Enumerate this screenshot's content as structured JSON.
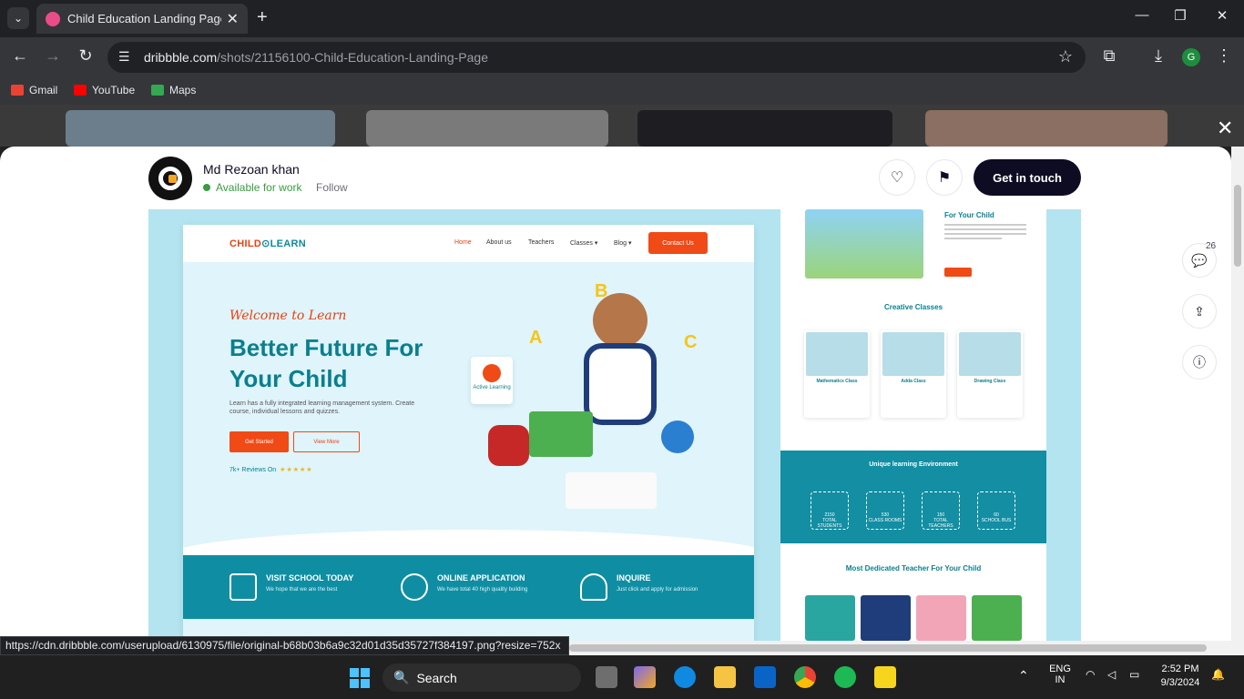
{
  "browser": {
    "tab_title": "Child Education Landing Page b",
    "new_tab": "+",
    "url_domain": "dribbble.com",
    "url_path": "/shots/21156100-Child-Education-Landing-Page",
    "profile_initial": "G",
    "bookmarks": [
      "Gmail",
      "YouTube",
      "Maps"
    ],
    "status_url": "https://cdn.dribbble.com/userupload/6130975/file/original-b68b03b6a9c32d01d35d35727f384197.png?resize=752x"
  },
  "shot_header": {
    "author": "Md Rezoan khan",
    "availability": "Available for work",
    "follow": "Follow",
    "get_in_touch": "Get in touch",
    "comment_count": "26"
  },
  "landing": {
    "logo_left": "CHILD",
    "logo_right": "LEARN",
    "nav": [
      "Home",
      "About us",
      "Teachers",
      "Classes ▾",
      "Blog ▾"
    ],
    "contact_button": "Contact Us",
    "welcome": "Welcome to Learn",
    "title": "Better Future For Your Child",
    "description": "Learn has a fully integrated learning management system. Create course, individual lessons and quizzes.",
    "get_started": "Get Started",
    "view_more": "View More",
    "reviews": "7k+ Reviews On",
    "stars": "★★★★★",
    "active_learning": "Active Learning",
    "features": [
      {
        "title": "VISIT SCHOOL TODAY",
        "sub": "We hope that we are the best"
      },
      {
        "title": "ONLINE APPLICATION",
        "sub": "We have total 40 high quality building"
      },
      {
        "title": "INQUIRE",
        "sub": "Just click and apply for admission"
      }
    ]
  },
  "right_panel": {
    "for_your_child": "For Your Child",
    "creative_classes": "Creative Classes",
    "classes": [
      "Mathematics Class",
      "Adda Class",
      "Drawing Class"
    ],
    "unique_env": "Unique learning Environment",
    "stats": [
      {
        "value": "2150",
        "label": "TOTAL STUDENTS"
      },
      {
        "value": "530",
        "label": "CLASS ROOMS"
      },
      {
        "value": "150",
        "label": "TOTAL TEACHERS"
      },
      {
        "value": "60",
        "label": "SCHOOL BUS"
      }
    ],
    "teacher_title": "Most Dedicated Teacher For Your Child"
  },
  "taskbar": {
    "search": "Search",
    "lang_top": "ENG",
    "lang_bottom": "IN",
    "time": "2:52 PM",
    "date": "9/3/2024"
  }
}
